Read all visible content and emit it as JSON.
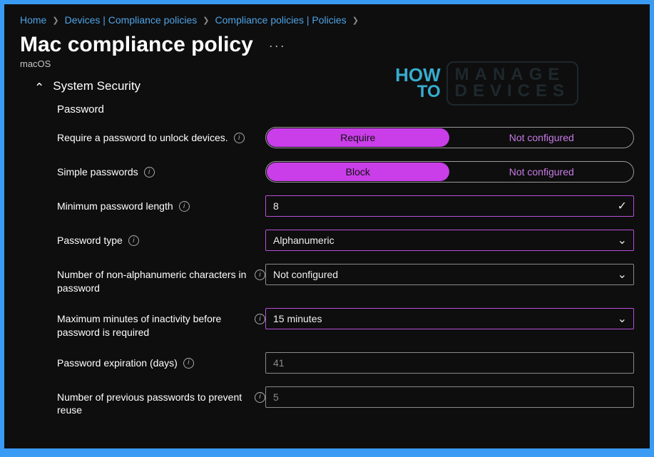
{
  "breadcrumb": {
    "home": "Home",
    "devices": "Devices | Compliance policies",
    "policies": "Compliance policies | Policies"
  },
  "page": {
    "title": "Mac compliance policy",
    "platform": "macOS",
    "more": "···"
  },
  "watermark": {
    "how": "HOW",
    "to": "TO",
    "line1": "MANAGE",
    "line2": "DEVICES"
  },
  "section": {
    "title": "System Security",
    "password_heading": "Password"
  },
  "labels": {
    "require_password": "Require a password to unlock devices.",
    "simple_passwords": "Simple passwords",
    "min_length": "Minimum password length",
    "password_type": "Password type",
    "non_alpha": "Number of non-alphanumeric characters in password",
    "inactivity": "Maximum minutes of inactivity before password is required",
    "expiration": "Password expiration (days)",
    "prevent_reuse": "Number of previous passwords to prevent reuse"
  },
  "toggles": {
    "require_password": {
      "active": "Require",
      "inactive": "Not configured"
    },
    "simple_passwords": {
      "active": "Block",
      "inactive": "Not configured"
    }
  },
  "values": {
    "min_length": "8",
    "password_type": "Alphanumeric",
    "non_alpha": "Not configured",
    "inactivity": "15 minutes",
    "expiration": "41",
    "prevent_reuse": "5"
  }
}
